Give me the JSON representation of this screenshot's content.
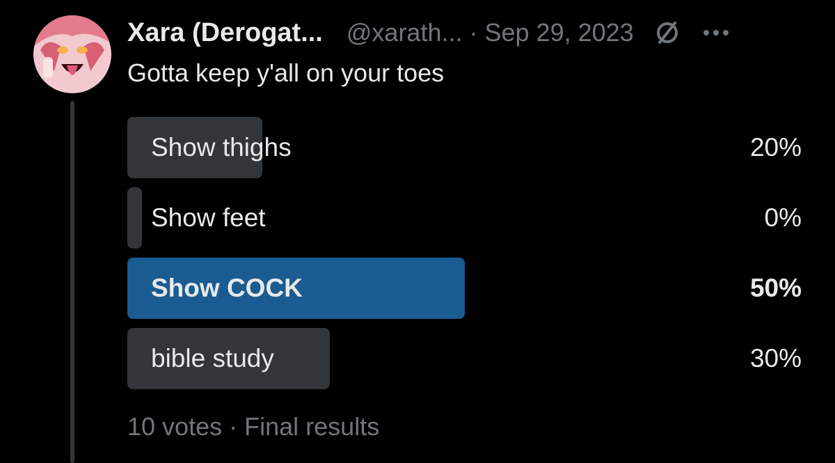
{
  "author": {
    "name": "Xara (Derogat...",
    "handle": "@xarath...",
    "separator": "·",
    "date": "Sep 29, 2023"
  },
  "tweet": {
    "text": "Gotta keep y'all on your toes"
  },
  "poll": {
    "options": [
      {
        "label": "Show thighs",
        "percent_text": "20%",
        "percent": 20,
        "winner": false
      },
      {
        "label": "Show feet",
        "percent_text": "0%",
        "percent": 0,
        "winner": false
      },
      {
        "label": "Show COCK",
        "percent_text": "50%",
        "percent": 50,
        "winner": true
      },
      {
        "label": "bible study",
        "percent_text": "30%",
        "percent": 30,
        "winner": false
      }
    ],
    "votes": "10 votes",
    "separator": "·",
    "status": "Final results"
  },
  "icons": {
    "avatar": "avatar",
    "premium": "slashed-circle-icon",
    "more": "more-horizontal-icon"
  },
  "colors": {
    "background": "#000000",
    "text_primary": "#e7e9ea",
    "text_secondary": "#71767b",
    "bar": "#333639",
    "bar_winner": "#1a5c91"
  }
}
